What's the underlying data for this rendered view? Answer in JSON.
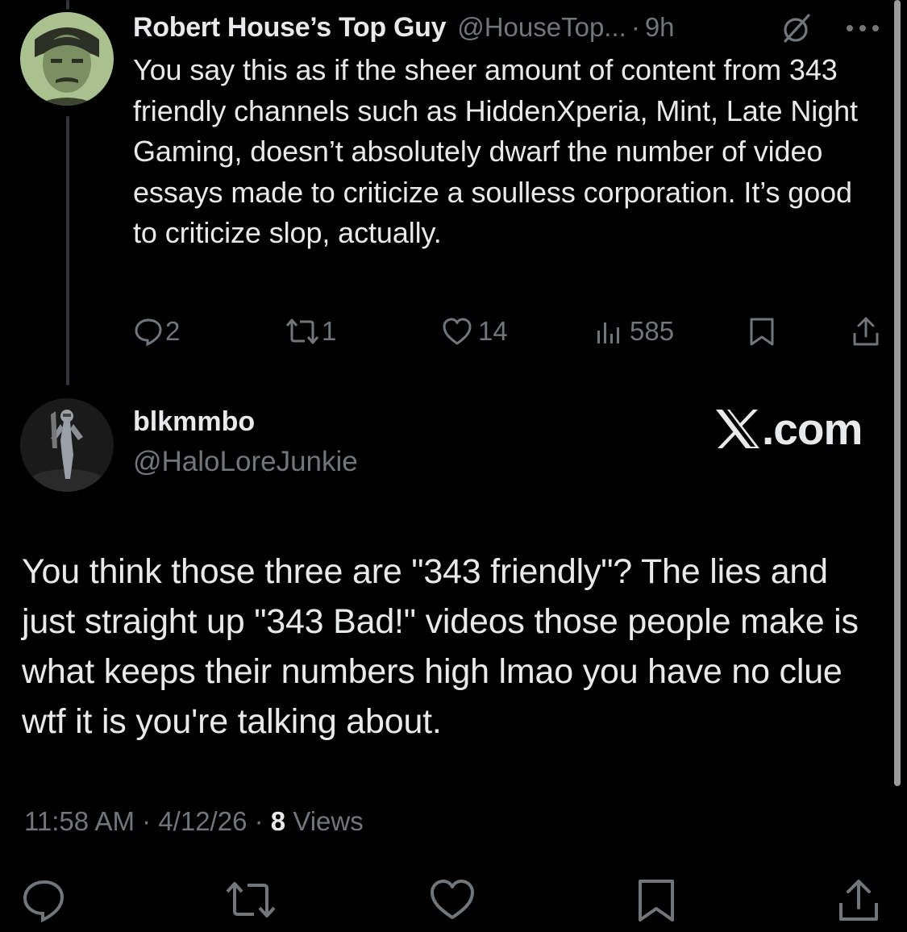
{
  "parent_tweet": {
    "display_name": "Robert House’s Top Guy",
    "handle": "@HouseTop...",
    "separator": "·",
    "time": "9h",
    "text": "You say this as if the sheer amount of content from 343 friendly channels such as HiddenXperia, Mint, Late Night Gaming, doesn’t absolutely dwarf the number of video essays made to criticize a soulless corporation. It’s good to criticize slop, actually.",
    "replies": "2",
    "reposts": "1",
    "likes": "14",
    "views": "585"
  },
  "reply_tweet": {
    "display_name": "blkmmbo",
    "handle": "@HaloLoreJunkie",
    "text": "You think those three are \"343 friendly\"? The lies and just straight up \"343 Bad!\" videos those people make is what keeps their numbers high lmao you have no clue wtf it is you're talking about.",
    "time": "11:58 AM",
    "date": "4/12/26",
    "separator": "·",
    "view_count": "8",
    "views_label": "Views"
  },
  "brand": {
    "logo": "X",
    "suffix": ".com"
  },
  "icons": {
    "reply": "reply-icon",
    "repost": "repost-icon",
    "like": "heart-icon",
    "views": "views-icon",
    "bookmark": "bookmark-icon",
    "share": "share-icon",
    "grok": "grok-icon",
    "more": "more-icon"
  },
  "colors": {
    "background": "#000000",
    "text": "#e7e9ea",
    "secondary": "#71767b"
  }
}
